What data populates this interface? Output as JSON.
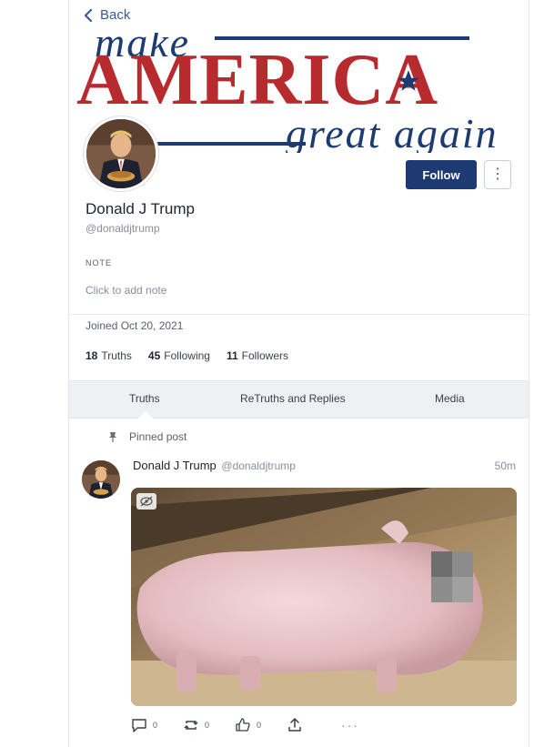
{
  "nav": {
    "back_label": "Back"
  },
  "banner": {
    "line1": "make",
    "line2": "AMERICA",
    "line3": "great again",
    "colors": {
      "red": "#b72b2f",
      "blue": "#1e3a72"
    }
  },
  "profile": {
    "name": "Donald J Trump",
    "handle": "@donaldjtrump",
    "follow_label": "Follow",
    "more_label": "⋮",
    "note_label": "NOTE",
    "note_placeholder": "Click to add note",
    "joined": "Joined Oct 20, 2021",
    "stats": {
      "truths_count": "18",
      "truths_label": "Truths",
      "following_count": "45",
      "following_label": "Following",
      "followers_count": "11",
      "followers_label": "Followers"
    }
  },
  "tabs": [
    {
      "label": "Truths",
      "active": true
    },
    {
      "label": "ReTruths and Replies",
      "active": false
    },
    {
      "label": "Media",
      "active": false
    }
  ],
  "post": {
    "pinned_label": "Pinned post",
    "author_name": "Donald J Trump",
    "author_handle": "@donaldjtrump",
    "time": "50m",
    "actions": {
      "reply_count": "0",
      "retruth_count": "0",
      "like_count": "0"
    }
  },
  "icons": {
    "back": "chevron-left-icon",
    "more": "vertical-dots-icon",
    "pin": "pin-icon",
    "sensitive": "eye-off-icon",
    "reply": "speech-bubble-icon",
    "retruth": "repost-icon",
    "like": "thumbs-up-icon",
    "share": "share-icon",
    "overflow": "horizontal-dots-icon"
  },
  "theme": {
    "accent": "#1e3a72",
    "link": "#3a5a99"
  }
}
